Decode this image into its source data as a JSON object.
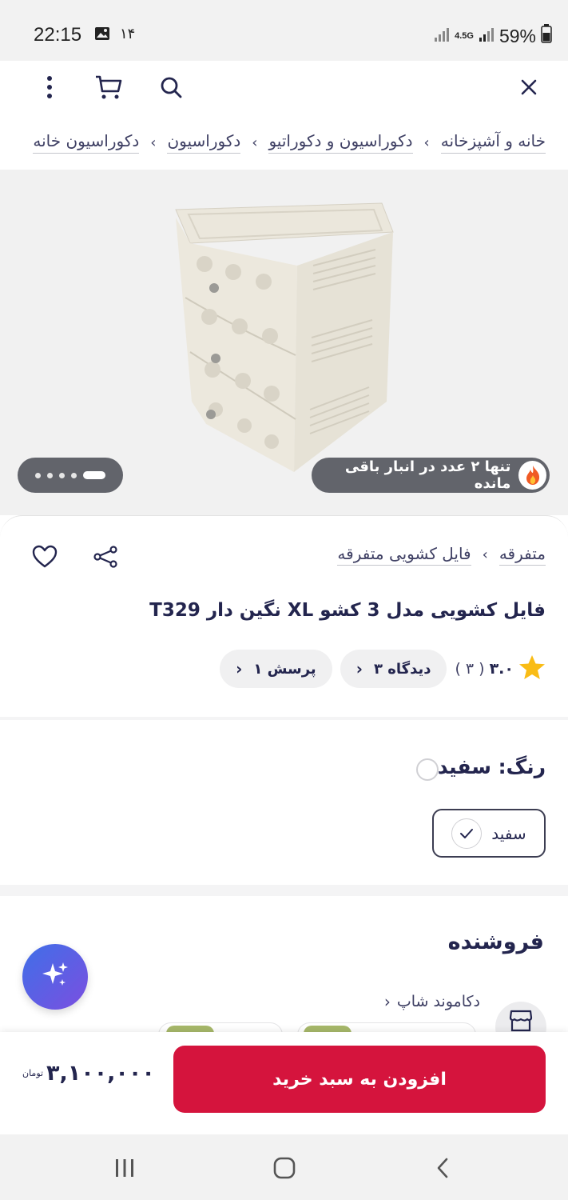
{
  "status_bar": {
    "time": "22:15",
    "notification": "۱۴",
    "network": "4.5G",
    "battery": "59%"
  },
  "top_bar": {
    "icons": [
      "close-icon",
      "search-icon",
      "cart-icon",
      "more-vertical-icon"
    ]
  },
  "breadcrumb": {
    "items": [
      "خانه و آشپزخانه",
      "دکوراسیون و دکوراتیو",
      "دکوراسیون",
      "دکوراسیون خانه"
    ]
  },
  "gallery": {
    "stock_notice": "تنها ۲ عدد در انبار باقی مانده",
    "dot_count": 5,
    "active_dot": 0
  },
  "product": {
    "category_main": "متفرقه",
    "category_sub": "فایل کشویی متفرقه",
    "title": "فایل کشویی مدل 3 کشو XL نگین دار T329",
    "rating": "۳.۰",
    "rating_count": "( ۳ )",
    "reviews_label": "۳ دیدگاه",
    "questions_label": "۱ پرسش"
  },
  "color": {
    "label": "رنگ: سفید",
    "option_label": "سفید",
    "swatch": "#ffffff"
  },
  "seller": {
    "title": "فروشنده",
    "name": "دکاموند شاپ"
  },
  "buy_bar": {
    "add_to_cart_label": "افزودن به سبد خرید",
    "price": "۳,۱۰۰,۰۰۰",
    "currency": "تومان"
  },
  "colors": {
    "primary_red": "#d5143d",
    "text_dark": "#23254e",
    "badge_gray": "#62646b"
  }
}
